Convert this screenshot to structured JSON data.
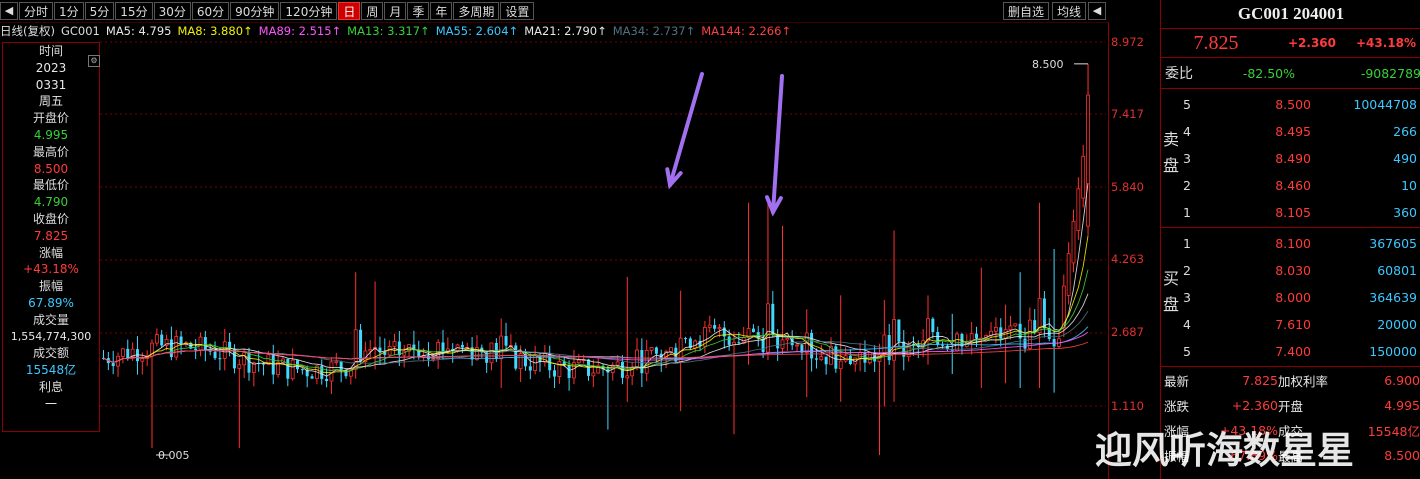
{
  "toolbar": {
    "left_icon": "◀",
    "tabs": [
      "分时",
      "1分",
      "5分",
      "15分",
      "30分",
      "60分",
      "90分钟",
      "120分钟",
      "日",
      "周",
      "月",
      "季",
      "年",
      "多周期",
      "设置"
    ],
    "active_index": 8,
    "right": {
      "delete_self": "删自选",
      "ma": "均线",
      "back": "◀"
    }
  },
  "ma_line": {
    "head": "日线(复权)",
    "code": "GC001",
    "items": [
      {
        "text": "MA5: 4.795",
        "color": "#e8e8e8"
      },
      {
        "text": "MA8: 3.880↑",
        "color": "#f0f000"
      },
      {
        "text": "MA89: 2.515↑",
        "color": "#ff55ff"
      },
      {
        "text": "MA13: 3.317↑",
        "color": "#38d038"
      },
      {
        "text": "MA55: 2.604↑",
        "color": "#3cc8ff"
      },
      {
        "text": "MA21: 2.790↑",
        "color": "#e8e8e8"
      },
      {
        "text": "MA34: 2.737↑",
        "color": "#507080"
      },
      {
        "text": "MA144: 2.266↑",
        "color": "#ff4040"
      }
    ]
  },
  "info_panel": {
    "time_label": "时间",
    "year": "2023",
    "date": "0331",
    "weekday": "周五",
    "open_label": "开盘价",
    "open": "4.995",
    "high_label": "最高价",
    "high": "8.500",
    "low_label": "最低价",
    "low": "4.790",
    "close_label": "收盘价",
    "close": "7.825",
    "change_label": "涨幅",
    "change": "+43.18%",
    "amplitude_label": "振幅",
    "amplitude": "67.89%",
    "volume_label": "成交量",
    "volume": "1,554,774,300",
    "amount_label": "成交额",
    "amount": "15548亿",
    "interest_label": "利息",
    "interest": "一"
  },
  "y_axis": {
    "ticks": [
      "8.972",
      "7.417",
      "5.840",
      "4.263",
      "2.687",
      "1.110"
    ]
  },
  "annotations": {
    "high_marker": "8.500",
    "low_marker": "0.005"
  },
  "right_panel": {
    "title": "GC001 204001",
    "price": "7.825",
    "change": "+2.360",
    "change_pct": "+43.18%",
    "weibi_label": "委比",
    "weibi": "-82.50%",
    "weicha": "-9082789",
    "sell_label": "卖盘",
    "buy_label": "买盘",
    "sell": [
      {
        "level": "5",
        "price": "8.500",
        "vol": "10044708"
      },
      {
        "level": "4",
        "price": "8.495",
        "vol": "266"
      },
      {
        "level": "3",
        "price": "8.490",
        "vol": "490"
      },
      {
        "level": "2",
        "price": "8.460",
        "vol": "10"
      },
      {
        "level": "1",
        "price": "8.105",
        "vol": "360"
      }
    ],
    "buy": [
      {
        "level": "1",
        "price": "8.100",
        "vol": "367605"
      },
      {
        "level": "2",
        "price": "8.030",
        "vol": "60801"
      },
      {
        "level": "3",
        "price": "8.000",
        "vol": "364639"
      },
      {
        "level": "4",
        "price": "7.610",
        "vol": "20000"
      },
      {
        "level": "5",
        "price": "7.400",
        "vol": "150000"
      }
    ],
    "stats": [
      {
        "l1": "最新",
        "v1": "7.825",
        "l2": "加权利率",
        "v2": "6.900"
      },
      {
        "l1": "涨跌",
        "v1": "+2.360",
        "l2": "开盘",
        "v2": "4.995"
      },
      {
        "l1": "涨幅",
        "v1": "+43.18%",
        "l2": "成交",
        "v2": "15548亿"
      },
      {
        "l1": "振幅",
        "v1": "67.89%",
        "l2": "最高",
        "v2": "8.500"
      }
    ]
  },
  "watermark": "迎风听海数星星"
}
